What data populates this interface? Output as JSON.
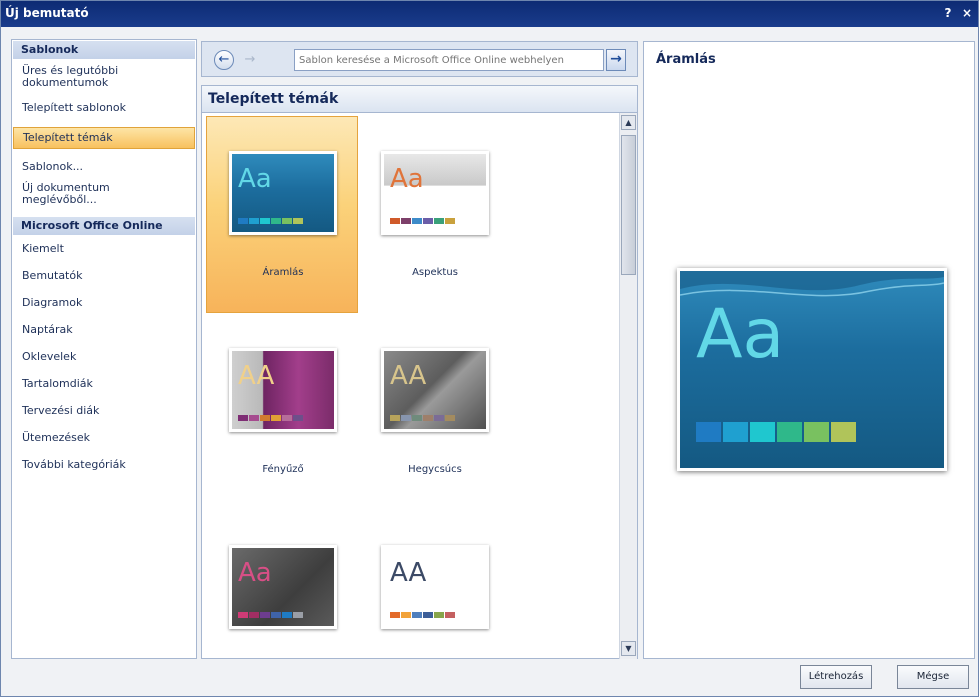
{
  "window": {
    "title": "Új bemutató",
    "help_label": "?",
    "close_label": "×"
  },
  "sidebar": {
    "headers": [
      "Sablonok",
      "Microsoft Office Online"
    ],
    "items": [
      {
        "label": "Üres és legutóbbi dokumentumok"
      },
      {
        "label": "Telepített sablonok"
      },
      {
        "label": "Telepített témák",
        "selected": true
      },
      {
        "label": "Sablonok..."
      },
      {
        "label": "Új dokumentum meglévőből..."
      }
    ],
    "online_items": [
      {
        "label": "Kiemelt"
      },
      {
        "label": "Bemutatók"
      },
      {
        "label": "Diagramok"
      },
      {
        "label": "Naptárak"
      },
      {
        "label": "Oklevelek"
      },
      {
        "label": "Tartalomdiák"
      },
      {
        "label": "Tervezési diák"
      },
      {
        "label": "Ütemezések"
      },
      {
        "label": "További kategóriák"
      }
    ]
  },
  "nav": {
    "back_icon": "←",
    "forward_icon": "→",
    "search_placeholder": "Sablon keresése a Microsoft Office Online webhelyen",
    "search_go_icon": "→"
  },
  "gallery": {
    "title": "Telepített témák",
    "tiles": [
      {
        "label": "Áramlás",
        "letters": "Aa",
        "selected": true
      },
      {
        "label": "Aspektus",
        "letters": "Aa"
      },
      {
        "label": "Fényűző",
        "letters": "AA"
      },
      {
        "label": "Hegycsúcs",
        "letters": "AA"
      },
      {
        "label": "",
        "letters": "Aa"
      },
      {
        "label": "",
        "letters": "AA"
      }
    ],
    "scroll_up": "▲",
    "scroll_down": "▼"
  },
  "preview": {
    "title": "Áramlás",
    "letters": "Aa"
  },
  "footer": {
    "create_label": "Létrehozás",
    "cancel_label": "Mégse"
  },
  "colors": {
    "accent_selected": "#fbd27a",
    "title_bar": "#0d2b74",
    "swatch_aramlas": [
      "#1f7bc3",
      "#1fa0d0",
      "#1fc7cf",
      "#2fb88a",
      "#79c160",
      "#b0c45a"
    ],
    "swatch_aspektus": [
      "#d05a2a",
      "#7d3f6a",
      "#3d8bc9",
      "#6b5da8",
      "#3aa07a",
      "#c9a13d"
    ],
    "swatch_fenyuzo": [
      "#7e2d74",
      "#a64b8f",
      "#d17b2f",
      "#e0a136",
      "#b66d9a",
      "#6d4f8a"
    ],
    "swatch_hegycsucs": [
      "#b7a35b",
      "#8795ae",
      "#6f8b7c",
      "#9e7f6a",
      "#7b6c96",
      "#a38b5f"
    ],
    "swatch_5": [
      "#d03b76",
      "#a22e63",
      "#6d3d8f",
      "#3f63a8",
      "#1f7bc3",
      "#9a9ea6"
    ],
    "swatch_6": [
      "#e36b2a",
      "#f2a33a",
      "#4f7fbd",
      "#3c5e98",
      "#87a54b",
      "#c46060"
    ]
  }
}
